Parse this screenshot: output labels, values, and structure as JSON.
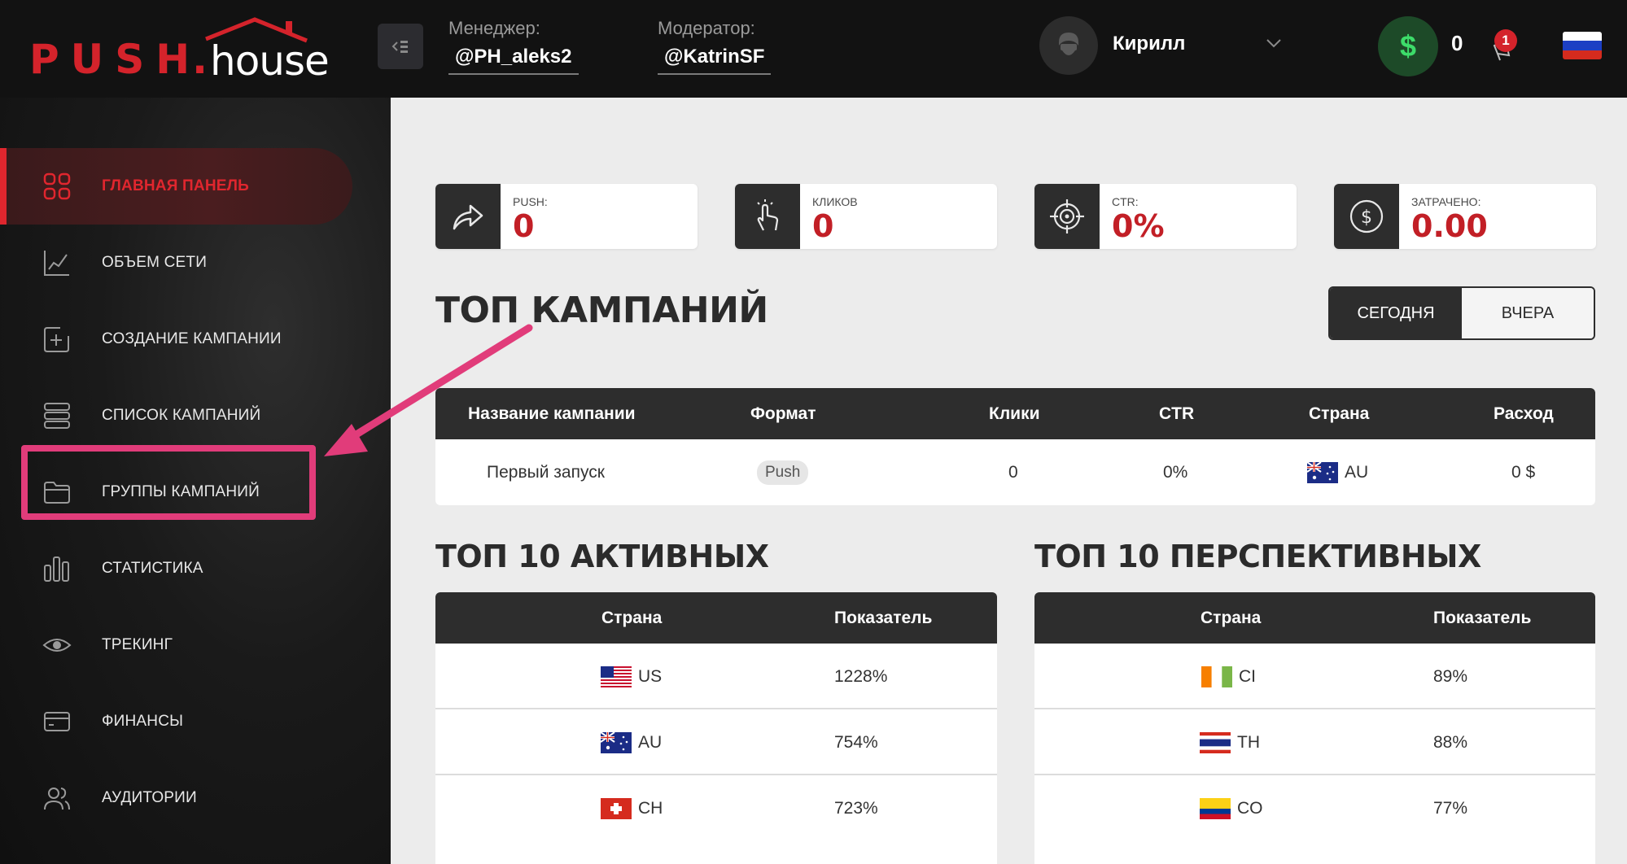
{
  "brand": {
    "push": "PUSH",
    "dot": ".",
    "house": "house"
  },
  "header": {
    "manager": {
      "label": "Менеджер:",
      "value": "@PH_aleks2"
    },
    "moderator": {
      "label": "Модератор:",
      "value": "@KatrinSF"
    },
    "user": {
      "name": "Кирилл"
    },
    "balance": {
      "symbol": "$",
      "value": "0"
    },
    "notifications": {
      "count": "1"
    },
    "language": "ru"
  },
  "sidebar": {
    "items": [
      {
        "label": "ГЛАВНАЯ ПАНЕЛЬ",
        "icon": "dashboard-icon",
        "active": true
      },
      {
        "label": "ОБЪЕМ СЕТИ",
        "icon": "chart-line-icon"
      },
      {
        "label": "СОЗДАНИЕ КАМПАНИИ",
        "icon": "add-square-icon"
      },
      {
        "label": "СПИСОК КАМПАНИЙ",
        "icon": "list-icon"
      },
      {
        "label": "ГРУППЫ КАМПАНИЙ",
        "icon": "folder-icon"
      },
      {
        "label": "СТАТИСТИКА",
        "icon": "bar-chart-icon"
      },
      {
        "label": "ТРЕКИНГ",
        "icon": "eye-icon"
      },
      {
        "label": "ФИНАНСЫ",
        "icon": "card-icon"
      },
      {
        "label": "АУДИТОРИИ",
        "icon": "users-icon"
      }
    ]
  },
  "stats": [
    {
      "label": "PUSH:",
      "value": "0",
      "icon": "share-arrow-icon"
    },
    {
      "label": "КЛИКОВ",
      "value": "0",
      "icon": "tap-hand-icon"
    },
    {
      "label": "CTR:",
      "value": "0%",
      "icon": "target-icon"
    },
    {
      "label": "ЗАТРАЧЕНО:",
      "value": "0.00",
      "icon": "dollar-circle-icon"
    }
  ],
  "top_campaigns": {
    "title": "ТОП КАМПАНИЙ",
    "period": {
      "today": "СЕГОДНЯ",
      "yesterday": "ВЧЕРА",
      "selected": "today"
    },
    "columns": [
      "Название кампании",
      "Формат",
      "Клики",
      "CTR",
      "Страна",
      "Расход"
    ],
    "rows": [
      {
        "name": "Первый запуск",
        "format": "Push",
        "clicks": "0",
        "ctr": "0%",
        "country": "AU",
        "spend": "0 $"
      }
    ]
  },
  "top_active": {
    "title": "ТОП 10 АКТИВНЫХ",
    "columns": [
      "Страна",
      "Показатель"
    ],
    "rows": [
      {
        "country": "US",
        "value": "1228%"
      },
      {
        "country": "AU",
        "value": "754%"
      },
      {
        "country": "CH",
        "value": "723%"
      }
    ]
  },
  "top_prospective": {
    "title": "ТОП 10 ПЕРСПЕКТИВНЫХ",
    "columns": [
      "Страна",
      "Показатель"
    ],
    "rows": [
      {
        "country": "CI",
        "value": "89%"
      },
      {
        "country": "TH",
        "value": "88%"
      },
      {
        "country": "CO",
        "value": "77%"
      }
    ]
  },
  "colors": {
    "accent": "#d4232b",
    "header_bg": "#121212",
    "table_header": "#2d2d2d",
    "highlight": "#e13c7a"
  }
}
